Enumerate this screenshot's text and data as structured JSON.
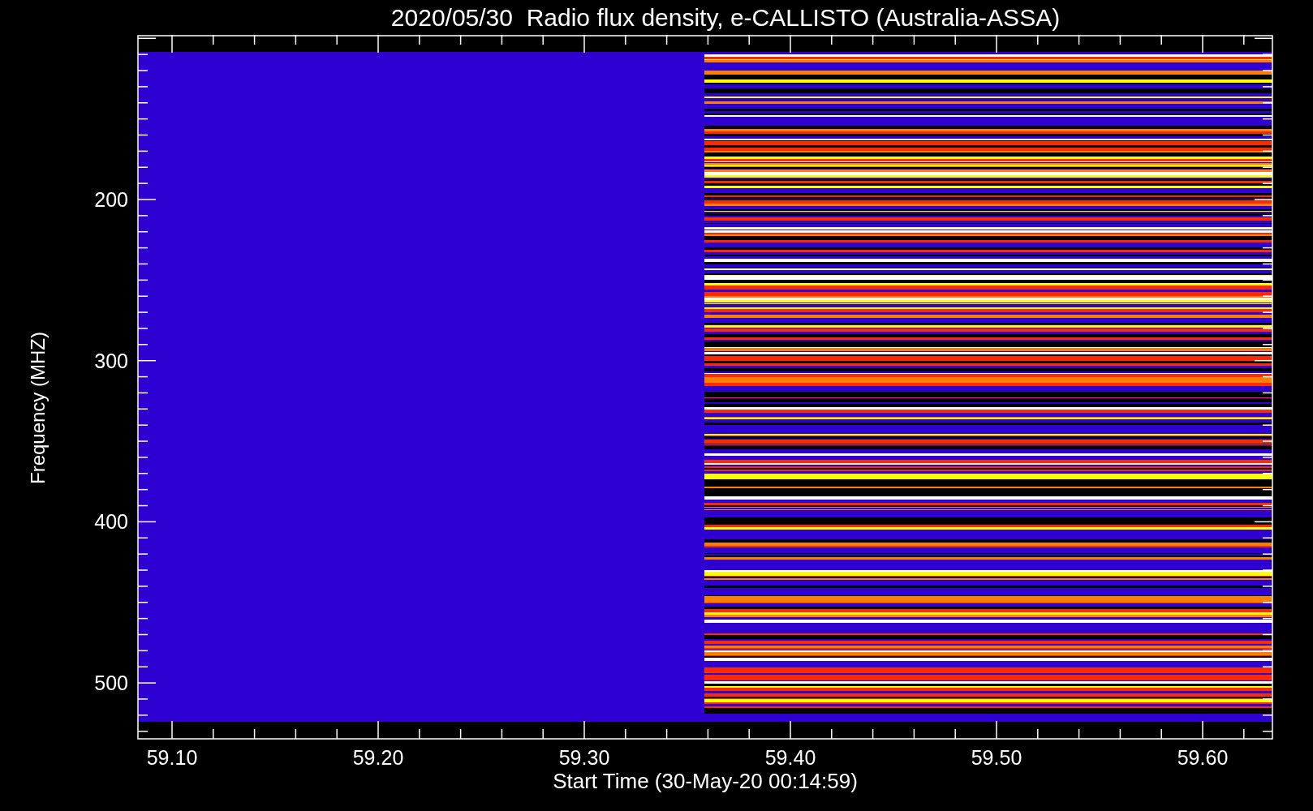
{
  "title": "2020/05/30  Radio flux density, e-CALLISTO (Australia-ASSA)",
  "y_axis": {
    "label": "Frequency (MHZ)",
    "ticks": [
      "200",
      "300",
      "400",
      "500"
    ]
  },
  "x_axis": {
    "label": "Start Time (30-May-20 00:14:59)",
    "ticks": [
      "59.10",
      "59.20",
      "59.30",
      "59.40",
      "59.50",
      "59.60"
    ]
  }
}
